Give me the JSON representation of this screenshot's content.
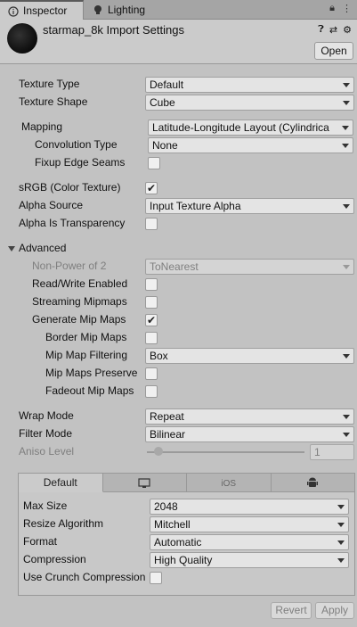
{
  "tabs": [
    {
      "label": "Inspector",
      "icon": "info-icon"
    },
    {
      "label": "Lighting",
      "icon": "bulb-icon"
    }
  ],
  "header": {
    "title": "starmap_8k Import Settings",
    "open_label": "Open"
  },
  "fields": {
    "texture_type": {
      "label": "Texture Type",
      "value": "Default"
    },
    "texture_shape": {
      "label": "Texture Shape",
      "value": "Cube"
    },
    "mapping": {
      "label": "Mapping",
      "value": "Latitude-Longitude Layout (Cylindrica"
    },
    "convolution_type": {
      "label": "Convolution Type",
      "value": "None"
    },
    "fixup_edge_seams": {
      "label": "Fixup Edge Seams",
      "checked": false
    },
    "srgb": {
      "label": "sRGB (Color Texture)",
      "checked": true
    },
    "alpha_source": {
      "label": "Alpha Source",
      "value": "Input Texture Alpha"
    },
    "alpha_is_transparency": {
      "label": "Alpha Is Transparency",
      "checked": false
    },
    "advanced": {
      "label": "Advanced"
    },
    "non_power_of_2": {
      "label": "Non-Power of 2",
      "value": "ToNearest"
    },
    "read_write": {
      "label": "Read/Write Enabled",
      "checked": false
    },
    "streaming_mipmaps": {
      "label": "Streaming Mipmaps",
      "checked": false
    },
    "generate_mip_maps": {
      "label": "Generate Mip Maps",
      "checked": true
    },
    "border_mip_maps": {
      "label": "Border Mip Maps",
      "checked": false
    },
    "mip_map_filtering": {
      "label": "Mip Map Filtering",
      "value": "Box"
    },
    "mip_maps_preserve": {
      "label": "Mip Maps Preserve",
      "checked": false
    },
    "fadeout_mip_maps": {
      "label": "Fadeout Mip Maps",
      "checked": false
    },
    "wrap_mode": {
      "label": "Wrap Mode",
      "value": "Repeat"
    },
    "filter_mode": {
      "label": "Filter Mode",
      "value": "Bilinear"
    },
    "aniso_level": {
      "label": "Aniso Level",
      "value": "1"
    }
  },
  "platform": {
    "tabs": [
      {
        "label": "Default",
        "icon": ""
      },
      {
        "label": "",
        "icon": "monitor-icon"
      },
      {
        "label": "iOS",
        "icon": ""
      },
      {
        "label": "",
        "icon": "android-icon"
      }
    ],
    "max_size": {
      "label": "Max Size",
      "value": "2048"
    },
    "resize_algorithm": {
      "label": "Resize Algorithm",
      "value": "Mitchell"
    },
    "format": {
      "label": "Format",
      "value": "Automatic"
    },
    "compression": {
      "label": "Compression",
      "value": "High Quality"
    },
    "use_crunch": {
      "label": "Use Crunch Compression",
      "checked": false
    }
  },
  "footer": {
    "revert_label": "Revert",
    "apply_label": "Apply"
  }
}
